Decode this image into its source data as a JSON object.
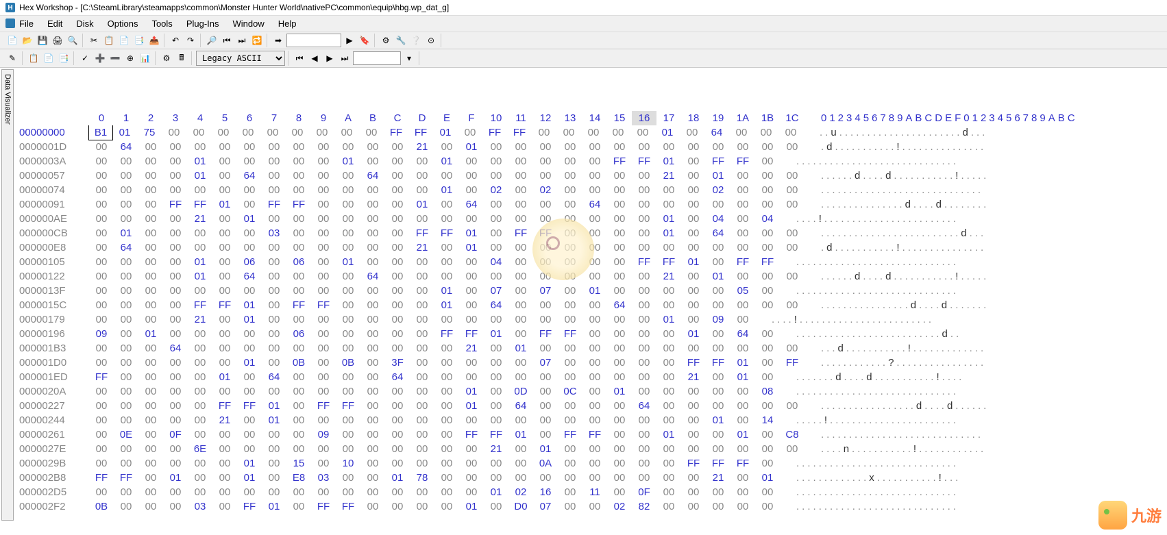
{
  "app": {
    "title": "Hex Workshop - [C:\\SteamLibrary\\steamapps\\common\\Monster Hunter World\\nativePC\\common\\equip\\hbg.wp_dat_g]",
    "icon_letter": "H"
  },
  "menu": [
    "File",
    "Edit",
    "Disk",
    "Options",
    "Tools",
    "Plug-Ins",
    "Window",
    "Help"
  ],
  "toolbar": {
    "encoding_select": "Legacy ASCII",
    "search_value": "",
    "nav_value": ""
  },
  "sidetab": {
    "label": "Data Visualizer"
  },
  "hex": {
    "columns_per_row": 29,
    "header_bytes": [
      "0",
      "1",
      "2",
      "3",
      "4",
      "5",
      "6",
      "7",
      "8",
      "9",
      "A",
      "B",
      "C",
      "D",
      "E",
      "F",
      "10",
      "11",
      "12",
      "13",
      "14",
      "15",
      "16",
      "17",
      "18",
      "19",
      "1A",
      "1B",
      "1C"
    ],
    "ascii_header": "0123456789ABCDEF0123456789ABC",
    "highlight_header_index": 22,
    "cursor": {
      "row": 0,
      "col": 0
    },
    "rows": [
      {
        "off": "00000000",
        "b": [
          "B1",
          "01",
          "75",
          "00",
          "00",
          "00",
          "00",
          "00",
          "00",
          "00",
          "00",
          "00",
          "FF",
          "FF",
          "01",
          "00",
          "FF",
          "FF",
          "00",
          "00",
          "00",
          "00",
          "00",
          "01",
          "00",
          "64",
          "00",
          "00",
          "00"
        ],
        "a": "..u......................d..."
      },
      {
        "off": "0000001D",
        "b": [
          "00",
          "64",
          "00",
          "00",
          "00",
          "00",
          "00",
          "00",
          "00",
          "00",
          "00",
          "00",
          "00",
          "21",
          "00",
          "01",
          "00",
          "00",
          "00",
          "00",
          "00",
          "00",
          "00",
          "00",
          "00",
          "00",
          "00",
          "00",
          "00"
        ],
        "a": ".d...........!..............."
      },
      {
        "off": "0000003A",
        "b": [
          "00",
          "00",
          "00",
          "00",
          "01",
          "00",
          "00",
          "00",
          "00",
          "00",
          "01",
          "00",
          "00",
          "00",
          "01",
          "00",
          "00",
          "00",
          "00",
          "00",
          "00",
          "FF",
          "FF",
          "01",
          "00",
          "FF",
          "FF",
          "00"
        ],
        "a": "............................."
      },
      {
        "off": "00000057",
        "b": [
          "00",
          "00",
          "00",
          "00",
          "01",
          "00",
          "64",
          "00",
          "00",
          "00",
          "00",
          "64",
          "00",
          "00",
          "00",
          "00",
          "00",
          "00",
          "00",
          "00",
          "00",
          "00",
          "00",
          "21",
          "00",
          "01",
          "00",
          "00",
          "00"
        ],
        "a": "......d....d...........!....."
      },
      {
        "off": "00000074",
        "b": [
          "00",
          "00",
          "00",
          "00",
          "00",
          "00",
          "00",
          "00",
          "00",
          "00",
          "00",
          "00",
          "00",
          "00",
          "01",
          "00",
          "02",
          "00",
          "02",
          "00",
          "00",
          "00",
          "00",
          "00",
          "00",
          "02",
          "00",
          "00",
          "00"
        ],
        "a": "............................."
      },
      {
        "off": "00000091",
        "b": [
          "00",
          "00",
          "00",
          "FF",
          "FF",
          "01",
          "00",
          "FF",
          "FF",
          "00",
          "00",
          "00",
          "00",
          "01",
          "00",
          "64",
          "00",
          "00",
          "00",
          "00",
          "64",
          "00",
          "00",
          "00",
          "00",
          "00",
          "00",
          "00",
          "00"
        ],
        "a": "...............d....d........"
      },
      {
        "off": "000000AE",
        "b": [
          "00",
          "00",
          "00",
          "00",
          "21",
          "00",
          "01",
          "00",
          "00",
          "00",
          "00",
          "00",
          "00",
          "00",
          "00",
          "00",
          "00",
          "00",
          "00",
          "00",
          "00",
          "00",
          "00",
          "01",
          "00",
          "04",
          "00",
          "04"
        ],
        "a": "....!........................"
      },
      {
        "off": "000000CB",
        "b": [
          "00",
          "01",
          "00",
          "00",
          "00",
          "00",
          "00",
          "03",
          "00",
          "00",
          "00",
          "00",
          "00",
          "FF",
          "FF",
          "01",
          "00",
          "FF",
          "FF",
          "00",
          "00",
          "00",
          "00",
          "01",
          "00",
          "64",
          "00",
          "00",
          "00"
        ],
        "a": ".........................d..."
      },
      {
        "off": "000000E8",
        "b": [
          "00",
          "64",
          "00",
          "00",
          "00",
          "00",
          "00",
          "00",
          "00",
          "00",
          "00",
          "00",
          "00",
          "21",
          "00",
          "01",
          "00",
          "00",
          "00",
          "00",
          "00",
          "00",
          "00",
          "00",
          "00",
          "00",
          "00",
          "00",
          "00"
        ],
        "a": ".d...........!..............."
      },
      {
        "off": "00000105",
        "b": [
          "00",
          "00",
          "00",
          "00",
          "01",
          "00",
          "06",
          "00",
          "06",
          "00",
          "01",
          "00",
          "00",
          "00",
          "00",
          "00",
          "04",
          "00",
          "00",
          "00",
          "00",
          "00",
          "FF",
          "FF",
          "01",
          "00",
          "FF",
          "FF"
        ],
        "a": "............................."
      },
      {
        "off": "00000122",
        "b": [
          "00",
          "00",
          "00",
          "00",
          "01",
          "00",
          "64",
          "00",
          "00",
          "00",
          "00",
          "64",
          "00",
          "00",
          "00",
          "00",
          "00",
          "00",
          "00",
          "00",
          "00",
          "00",
          "00",
          "21",
          "00",
          "01",
          "00",
          "00",
          "00"
        ],
        "a": "......d....d...........!....."
      },
      {
        "off": "0000013F",
        "b": [
          "00",
          "00",
          "00",
          "00",
          "00",
          "00",
          "00",
          "00",
          "00",
          "00",
          "00",
          "00",
          "00",
          "00",
          "01",
          "00",
          "07",
          "00",
          "07",
          "00",
          "01",
          "00",
          "00",
          "00",
          "00",
          "00",
          "05",
          "00"
        ],
        "a": "............................."
      },
      {
        "off": "0000015C",
        "b": [
          "00",
          "00",
          "00",
          "00",
          "FF",
          "FF",
          "01",
          "00",
          "FF",
          "FF",
          "00",
          "00",
          "00",
          "00",
          "01",
          "00",
          "64",
          "00",
          "00",
          "00",
          "00",
          "64",
          "00",
          "00",
          "00",
          "00",
          "00",
          "00",
          "00"
        ],
        "a": "................d....d......."
      },
      {
        "off": "00000179",
        "b": [
          "00",
          "00",
          "00",
          "00",
          "21",
          "00",
          "01",
          "00",
          "00",
          "00",
          "00",
          "00",
          "00",
          "00",
          "00",
          "00",
          "00",
          "00",
          "00",
          "00",
          "00",
          "00",
          "00",
          "01",
          "00",
          "09",
          "00"
        ],
        "a": "....!........................"
      },
      {
        "off": "00000196",
        "b": [
          "09",
          "00",
          "01",
          "00",
          "00",
          "00",
          "00",
          "00",
          "06",
          "00",
          "00",
          "00",
          "00",
          "00",
          "FF",
          "FF",
          "01",
          "00",
          "FF",
          "FF",
          "00",
          "00",
          "00",
          "00",
          "01",
          "00",
          "64",
          "00"
        ],
        "a": "..........................d.."
      },
      {
        "off": "000001B3",
        "b": [
          "00",
          "00",
          "00",
          "64",
          "00",
          "00",
          "00",
          "00",
          "00",
          "00",
          "00",
          "00",
          "00",
          "00",
          "00",
          "21",
          "00",
          "01",
          "00",
          "00",
          "00",
          "00",
          "00",
          "00",
          "00",
          "00",
          "00",
          "00",
          "00"
        ],
        "a": "...d...........!............."
      },
      {
        "off": "000001D0",
        "b": [
          "00",
          "00",
          "00",
          "00",
          "00",
          "00",
          "01",
          "00",
          "0B",
          "00",
          "0B",
          "00",
          "3F",
          "00",
          "00",
          "00",
          "00",
          "00",
          "07",
          "00",
          "00",
          "00",
          "00",
          "00",
          "FF",
          "FF",
          "01",
          "00",
          "FF"
        ],
        "a": "............?................"
      },
      {
        "off": "000001ED",
        "b": [
          "FF",
          "00",
          "00",
          "00",
          "00",
          "01",
          "00",
          "64",
          "00",
          "00",
          "00",
          "00",
          "64",
          "00",
          "00",
          "00",
          "00",
          "00",
          "00",
          "00",
          "00",
          "00",
          "00",
          "00",
          "21",
          "00",
          "01",
          "00"
        ],
        "a": ".......d....d...........!...."
      },
      {
        "off": "0000020A",
        "b": [
          "00",
          "00",
          "00",
          "00",
          "00",
          "00",
          "00",
          "00",
          "00",
          "00",
          "00",
          "00",
          "00",
          "00",
          "00",
          "01",
          "00",
          "0D",
          "00",
          "0C",
          "00",
          "01",
          "00",
          "00",
          "00",
          "00",
          "00",
          "08"
        ],
        "a": "............................."
      },
      {
        "off": "00000227",
        "b": [
          "00",
          "00",
          "00",
          "00",
          "00",
          "FF",
          "FF",
          "01",
          "00",
          "FF",
          "FF",
          "00",
          "00",
          "00",
          "00",
          "01",
          "00",
          "64",
          "00",
          "00",
          "00",
          "00",
          "64",
          "00",
          "00",
          "00",
          "00",
          "00",
          "00"
        ],
        "a": ".................d....d......"
      },
      {
        "off": "00000244",
        "b": [
          "00",
          "00",
          "00",
          "00",
          "00",
          "21",
          "00",
          "01",
          "00",
          "00",
          "00",
          "00",
          "00",
          "00",
          "00",
          "00",
          "00",
          "00",
          "00",
          "00",
          "00",
          "00",
          "00",
          "00",
          "00",
          "01",
          "00",
          "14"
        ],
        "a": ".....!......................."
      },
      {
        "off": "00000261",
        "b": [
          "00",
          "0E",
          "00",
          "0F",
          "00",
          "00",
          "00",
          "00",
          "00",
          "09",
          "00",
          "00",
          "00",
          "00",
          "00",
          "FF",
          "FF",
          "01",
          "00",
          "FF",
          "FF",
          "00",
          "00",
          "01",
          "00",
          "00",
          "01",
          "00",
          "C8"
        ],
        "a": "............................."
      },
      {
        "off": "0000027E",
        "b": [
          "00",
          "00",
          "00",
          "00",
          "6E",
          "00",
          "00",
          "00",
          "00",
          "00",
          "00",
          "00",
          "00",
          "00",
          "00",
          "00",
          "21",
          "00",
          "01",
          "00",
          "00",
          "00",
          "00",
          "00",
          "00",
          "00",
          "00",
          "00",
          "00"
        ],
        "a": "....n...........!............"
      },
      {
        "off": "0000029B",
        "b": [
          "00",
          "00",
          "00",
          "00",
          "00",
          "00",
          "01",
          "00",
          "15",
          "00",
          "10",
          "00",
          "00",
          "00",
          "00",
          "00",
          "00",
          "00",
          "0A",
          "00",
          "00",
          "00",
          "00",
          "00",
          "FF",
          "FF",
          "FF",
          "00"
        ],
        "a": "............................."
      },
      {
        "off": "000002B8",
        "b": [
          "FF",
          "FF",
          "00",
          "01",
          "00",
          "00",
          "01",
          "00",
          "E8",
          "03",
          "00",
          "00",
          "01",
          "78",
          "00",
          "00",
          "00",
          "00",
          "00",
          "00",
          "00",
          "00",
          "00",
          "00",
          "00",
          "21",
          "00",
          "01"
        ],
        "a": ".............x...........!..."
      },
      {
        "off": "000002D5",
        "b": [
          "00",
          "00",
          "00",
          "00",
          "00",
          "00",
          "00",
          "00",
          "00",
          "00",
          "00",
          "00",
          "00",
          "00",
          "00",
          "00",
          "01",
          "02",
          "16",
          "00",
          "11",
          "00",
          "0F",
          "00",
          "00",
          "00",
          "00",
          "00"
        ],
        "a": "............................."
      },
      {
        "off": "000002F2",
        "b": [
          "0B",
          "00",
          "00",
          "00",
          "03",
          "00",
          "FF",
          "01",
          "00",
          "FF",
          "FF",
          "00",
          "00",
          "00",
          "00",
          "01",
          "00",
          "D0",
          "07",
          "00",
          "00",
          "02",
          "82",
          "00",
          "00",
          "00",
          "00",
          "00"
        ],
        "a": "............................."
      }
    ]
  },
  "watermark": {
    "text": "九游"
  }
}
